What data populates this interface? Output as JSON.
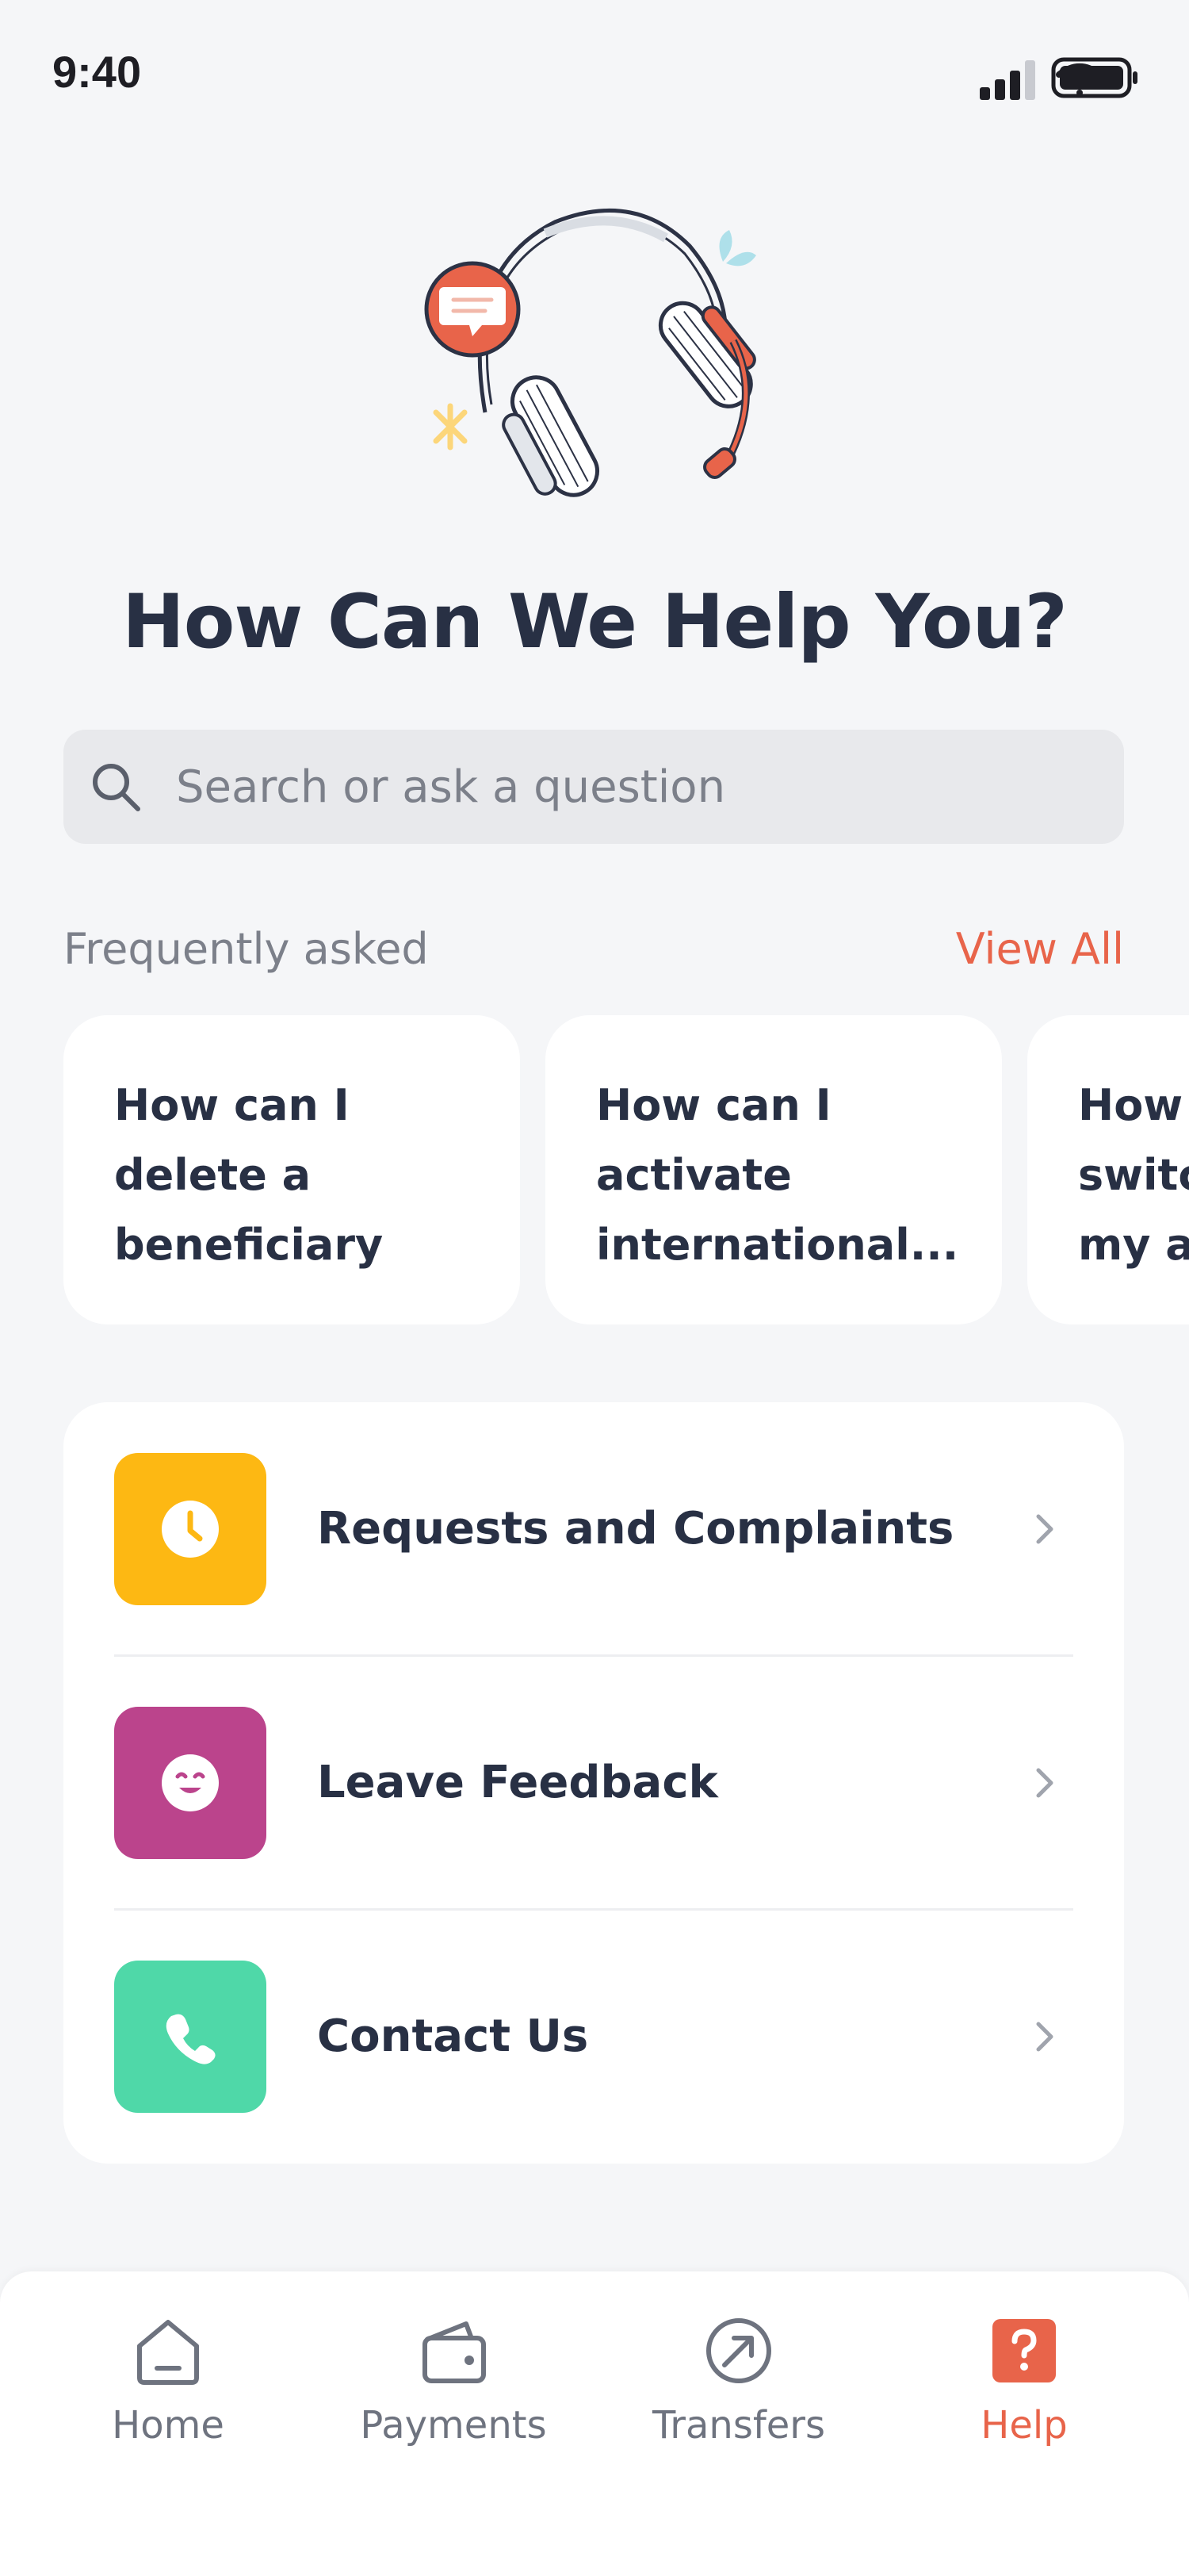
{
  "status_bar": {
    "time": "9:40"
  },
  "header": {
    "title": "How Can We Help You?"
  },
  "search": {
    "placeholder": "Search or ask a question",
    "value": ""
  },
  "faq": {
    "heading": "Frequently asked",
    "view_all_label": "View All",
    "cards": [
      {
        "text": "How can I\ndelete a\nbeneficiary"
      },
      {
        "text": "How can I\nactivate\ninternational..."
      },
      {
        "text": "How\nswitc\nmy ac"
      }
    ]
  },
  "actions": [
    {
      "label": "Requests and Complaints",
      "icon": "clock-icon",
      "color": "#FDB813"
    },
    {
      "label": "Leave Feedback",
      "icon": "smile-icon",
      "color": "#BB448C"
    },
    {
      "label": "Contact Us",
      "icon": "phone-icon",
      "color": "#4FD8A8"
    }
  ],
  "tab_bar": {
    "tabs": [
      {
        "label": "Home",
        "icon": "home-icon"
      },
      {
        "label": "Payments",
        "icon": "wallet-icon"
      },
      {
        "label": "Transfers",
        "icon": "transfer-arrow-icon"
      },
      {
        "label": "Help",
        "icon": "help-icon",
        "active": true
      }
    ]
  },
  "colors": {
    "accent": "#E8644A",
    "text_primary": "#283044",
    "text_secondary": "#7C808A",
    "background": "#F5F6F8"
  }
}
